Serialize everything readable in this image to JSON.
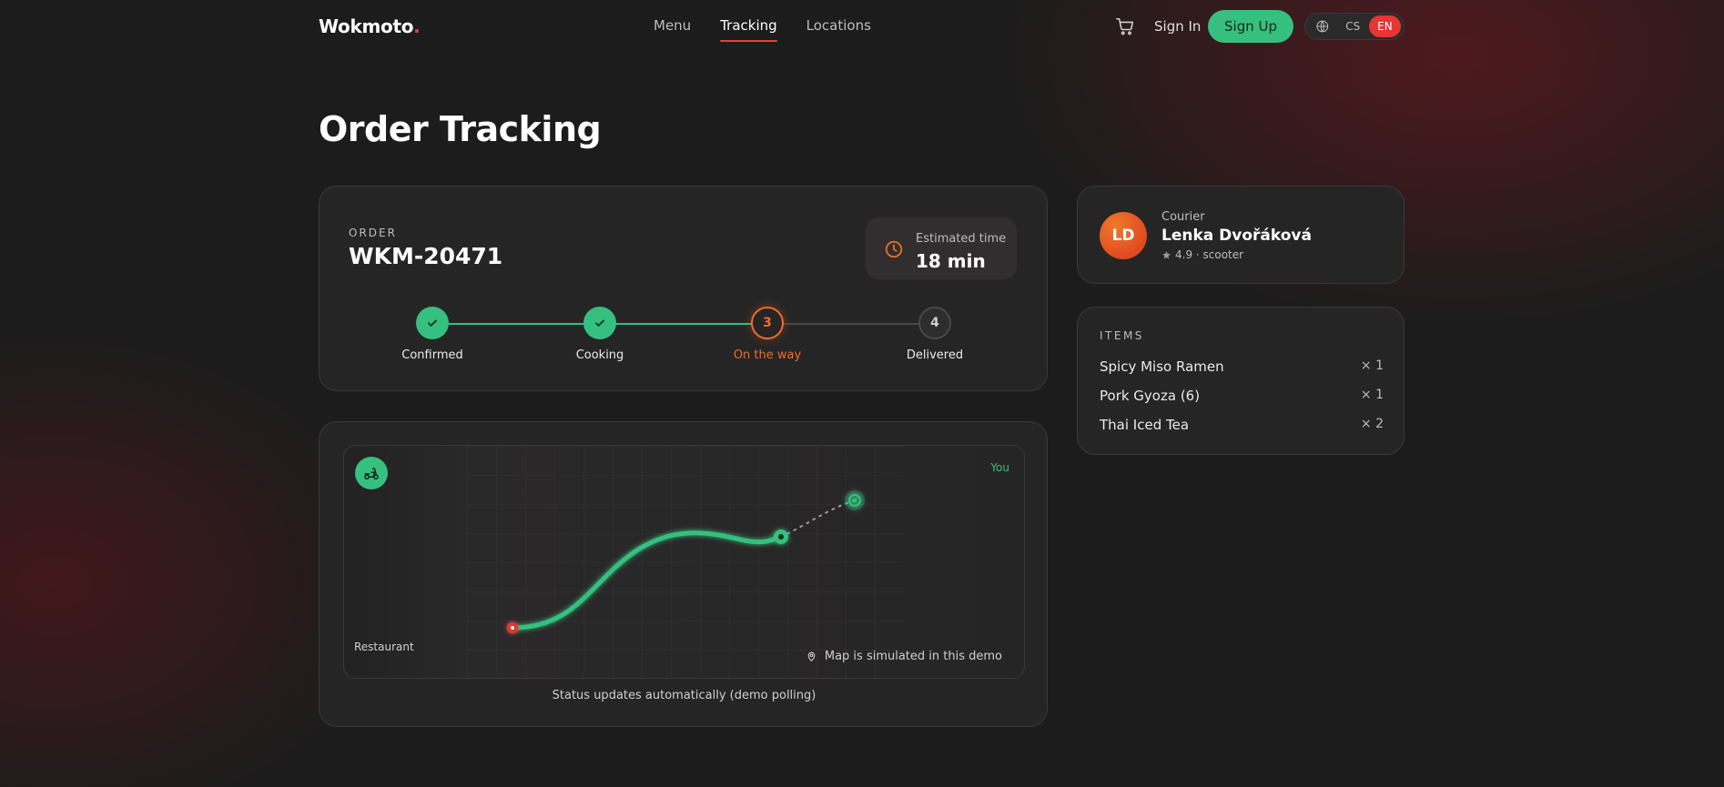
{
  "brand": {
    "name": "Wokmoto",
    "dot": ".",
    "accent": "#ef3a3a"
  },
  "nav": {
    "links": [
      {
        "label": "Menu",
        "active": false
      },
      {
        "label": "Tracking",
        "active": true
      },
      {
        "label": "Locations",
        "active": false
      }
    ],
    "cart_icon": "cart-icon",
    "signin_label": "Sign In",
    "signup_label": "Sign Up",
    "languages": [
      {
        "code": "CS",
        "active": false
      },
      {
        "code": "EN",
        "active": true
      }
    ]
  },
  "page": {
    "title": "Order Tracking"
  },
  "order": {
    "label": "ORDER",
    "id": "WKM-20471",
    "eta_label": "Estimated time",
    "eta_value": "18 min",
    "steps": [
      {
        "label": "Confirmed",
        "state": "done",
        "number": "1"
      },
      {
        "label": "Cooking",
        "state": "done",
        "number": "2"
      },
      {
        "label": "On the way",
        "state": "current",
        "number": "3"
      },
      {
        "label": "Delivered",
        "state": "todo",
        "number": "4"
      }
    ]
  },
  "map": {
    "you_label": "You",
    "restaurant_label": "Restaurant",
    "note": "Map is simulated in this demo",
    "status_note": "Status updates automatically (demo polling)"
  },
  "courier": {
    "label": "Courier",
    "initials": "LD",
    "name": "Lenka Dvořáková",
    "rating": "4.9",
    "vehicle": "scooter",
    "meta": "4.9 · scooter"
  },
  "items": {
    "title": "ITEMS",
    "list": [
      {
        "name": "Spicy Miso Ramen",
        "qty": "× 1"
      },
      {
        "name": "Pork Gyoza (6)",
        "qty": "× 1"
      },
      {
        "name": "Thai Iced Tea",
        "qty": "× 2"
      }
    ]
  },
  "colors": {
    "success": "#36c07f",
    "current": "#f26b2a",
    "danger": "#e53535"
  }
}
